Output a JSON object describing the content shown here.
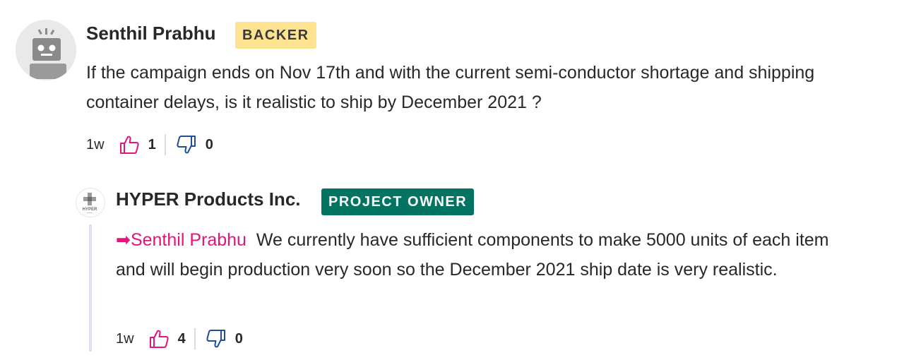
{
  "comment": {
    "author": "Senthil Prabhu",
    "badge": "BACKER",
    "body": "If the campaign ends on Nov 17th and with the current semi-conductor shortage and shipping container delays, is it realistic to ship by December 2021 ?",
    "age": "1w",
    "upvotes": "1",
    "downvotes": "0"
  },
  "reply": {
    "author": "HYPER Products Inc.",
    "badge": "PROJECT OWNER",
    "avatar_text": "HYPER",
    "mention": "Senthil Prabhu",
    "body": "We currently have sufficient components to make 5000 units of each item and will begin production very soon so the December 2021 ship date is very realistic.",
    "age": "1w",
    "upvotes": "4",
    "downvotes": "0"
  },
  "colors": {
    "accent": "#e2157a",
    "downvote": "#1f4e9a",
    "owner_badge": "#037362",
    "backer_badge": "#fde290"
  }
}
